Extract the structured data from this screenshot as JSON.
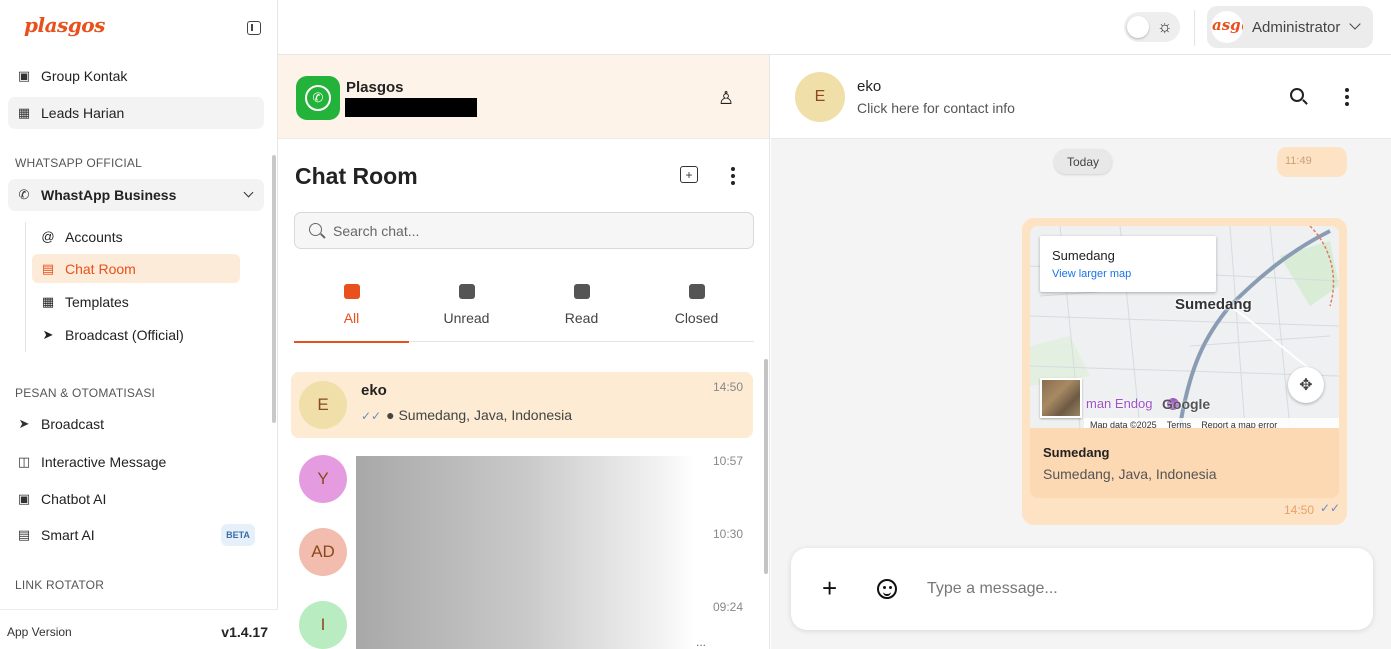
{
  "app": {
    "logo_text": "plasgos",
    "brand_color": "#e8501c"
  },
  "sidebar": {
    "items_top": [
      {
        "label": "Group Kontak",
        "icon": "contact-group-icon"
      },
      {
        "label": "Leads Harian",
        "icon": "calendar-icon"
      }
    ],
    "section_whatsapp": "WHATSAPP OFFICIAL",
    "whatsapp_business": {
      "label": "WhastApp Business",
      "icon": "whatsapp-icon",
      "expanded": true
    },
    "sub_items": [
      {
        "label": "Accounts",
        "icon": "at-icon"
      },
      {
        "label": "Chat Room",
        "icon": "chat-icon",
        "active": true
      },
      {
        "label": "Templates",
        "icon": "template-icon"
      },
      {
        "label": "Broadcast (Official)",
        "icon": "megaphone-icon"
      }
    ],
    "section_pesan": "PESAN & OTOMATISASI",
    "items_pesan": [
      {
        "label": "Broadcast",
        "icon": "send-icon"
      },
      {
        "label": "Interactive Message",
        "icon": "flow-icon"
      },
      {
        "label": "Chatbot AI",
        "icon": "robot-icon"
      },
      {
        "label": "Smart AI",
        "icon": "bot-chat-icon",
        "badge": "BETA"
      }
    ],
    "section_link": "LINK ROTATOR",
    "app_version_label": "App Version",
    "app_version": "v1.4.17"
  },
  "topbar": {
    "user_avatar_text": "asg(",
    "user_name": "Administrator",
    "theme": "light"
  },
  "device": {
    "name": "Plasgos"
  },
  "chat_room": {
    "title": "Chat Room",
    "search_placeholder": "Search chat...",
    "tabs": [
      {
        "label": "All",
        "active": true
      },
      {
        "label": "Unread"
      },
      {
        "label": "Read"
      },
      {
        "label": "Closed"
      }
    ],
    "chats": [
      {
        "initial": "E",
        "name": "eko",
        "time": "14:50",
        "preview": "Sumedang, Java, Indonesia",
        "avatar_color": "#f0dfa9",
        "active": true
      },
      {
        "initial": "Y",
        "name": "",
        "time": "10:57",
        "preview": "",
        "avatar_color": "#e59be0"
      },
      {
        "initial": "AD",
        "name": "",
        "time": "10:30",
        "preview": "",
        "avatar_color": "#f2bcae"
      },
      {
        "initial": "I",
        "name": "",
        "time": "09:24",
        "preview": "",
        "avatar_color": "#b9ecc0"
      }
    ],
    "truncated_preview_tail": "..."
  },
  "conversation": {
    "contact_initial": "E",
    "contact_name": "eko",
    "contact_sub": "Click here for contact info",
    "day_label": "Today",
    "previous_time": "11:49",
    "message": {
      "map_card_title": "Sumedang",
      "map_card_link": "View larger map",
      "map_city_label": "Sumedang",
      "map_place_label": "man Endog",
      "map_google": "Google",
      "map_data": "Map data ©2025",
      "map_terms": "Terms",
      "map_report": "Report a map error",
      "location_title": "Sumedang",
      "location_address": "Sumedang, Java, Indonesia",
      "time": "14:50"
    },
    "composer_placeholder": "Type a message..."
  }
}
